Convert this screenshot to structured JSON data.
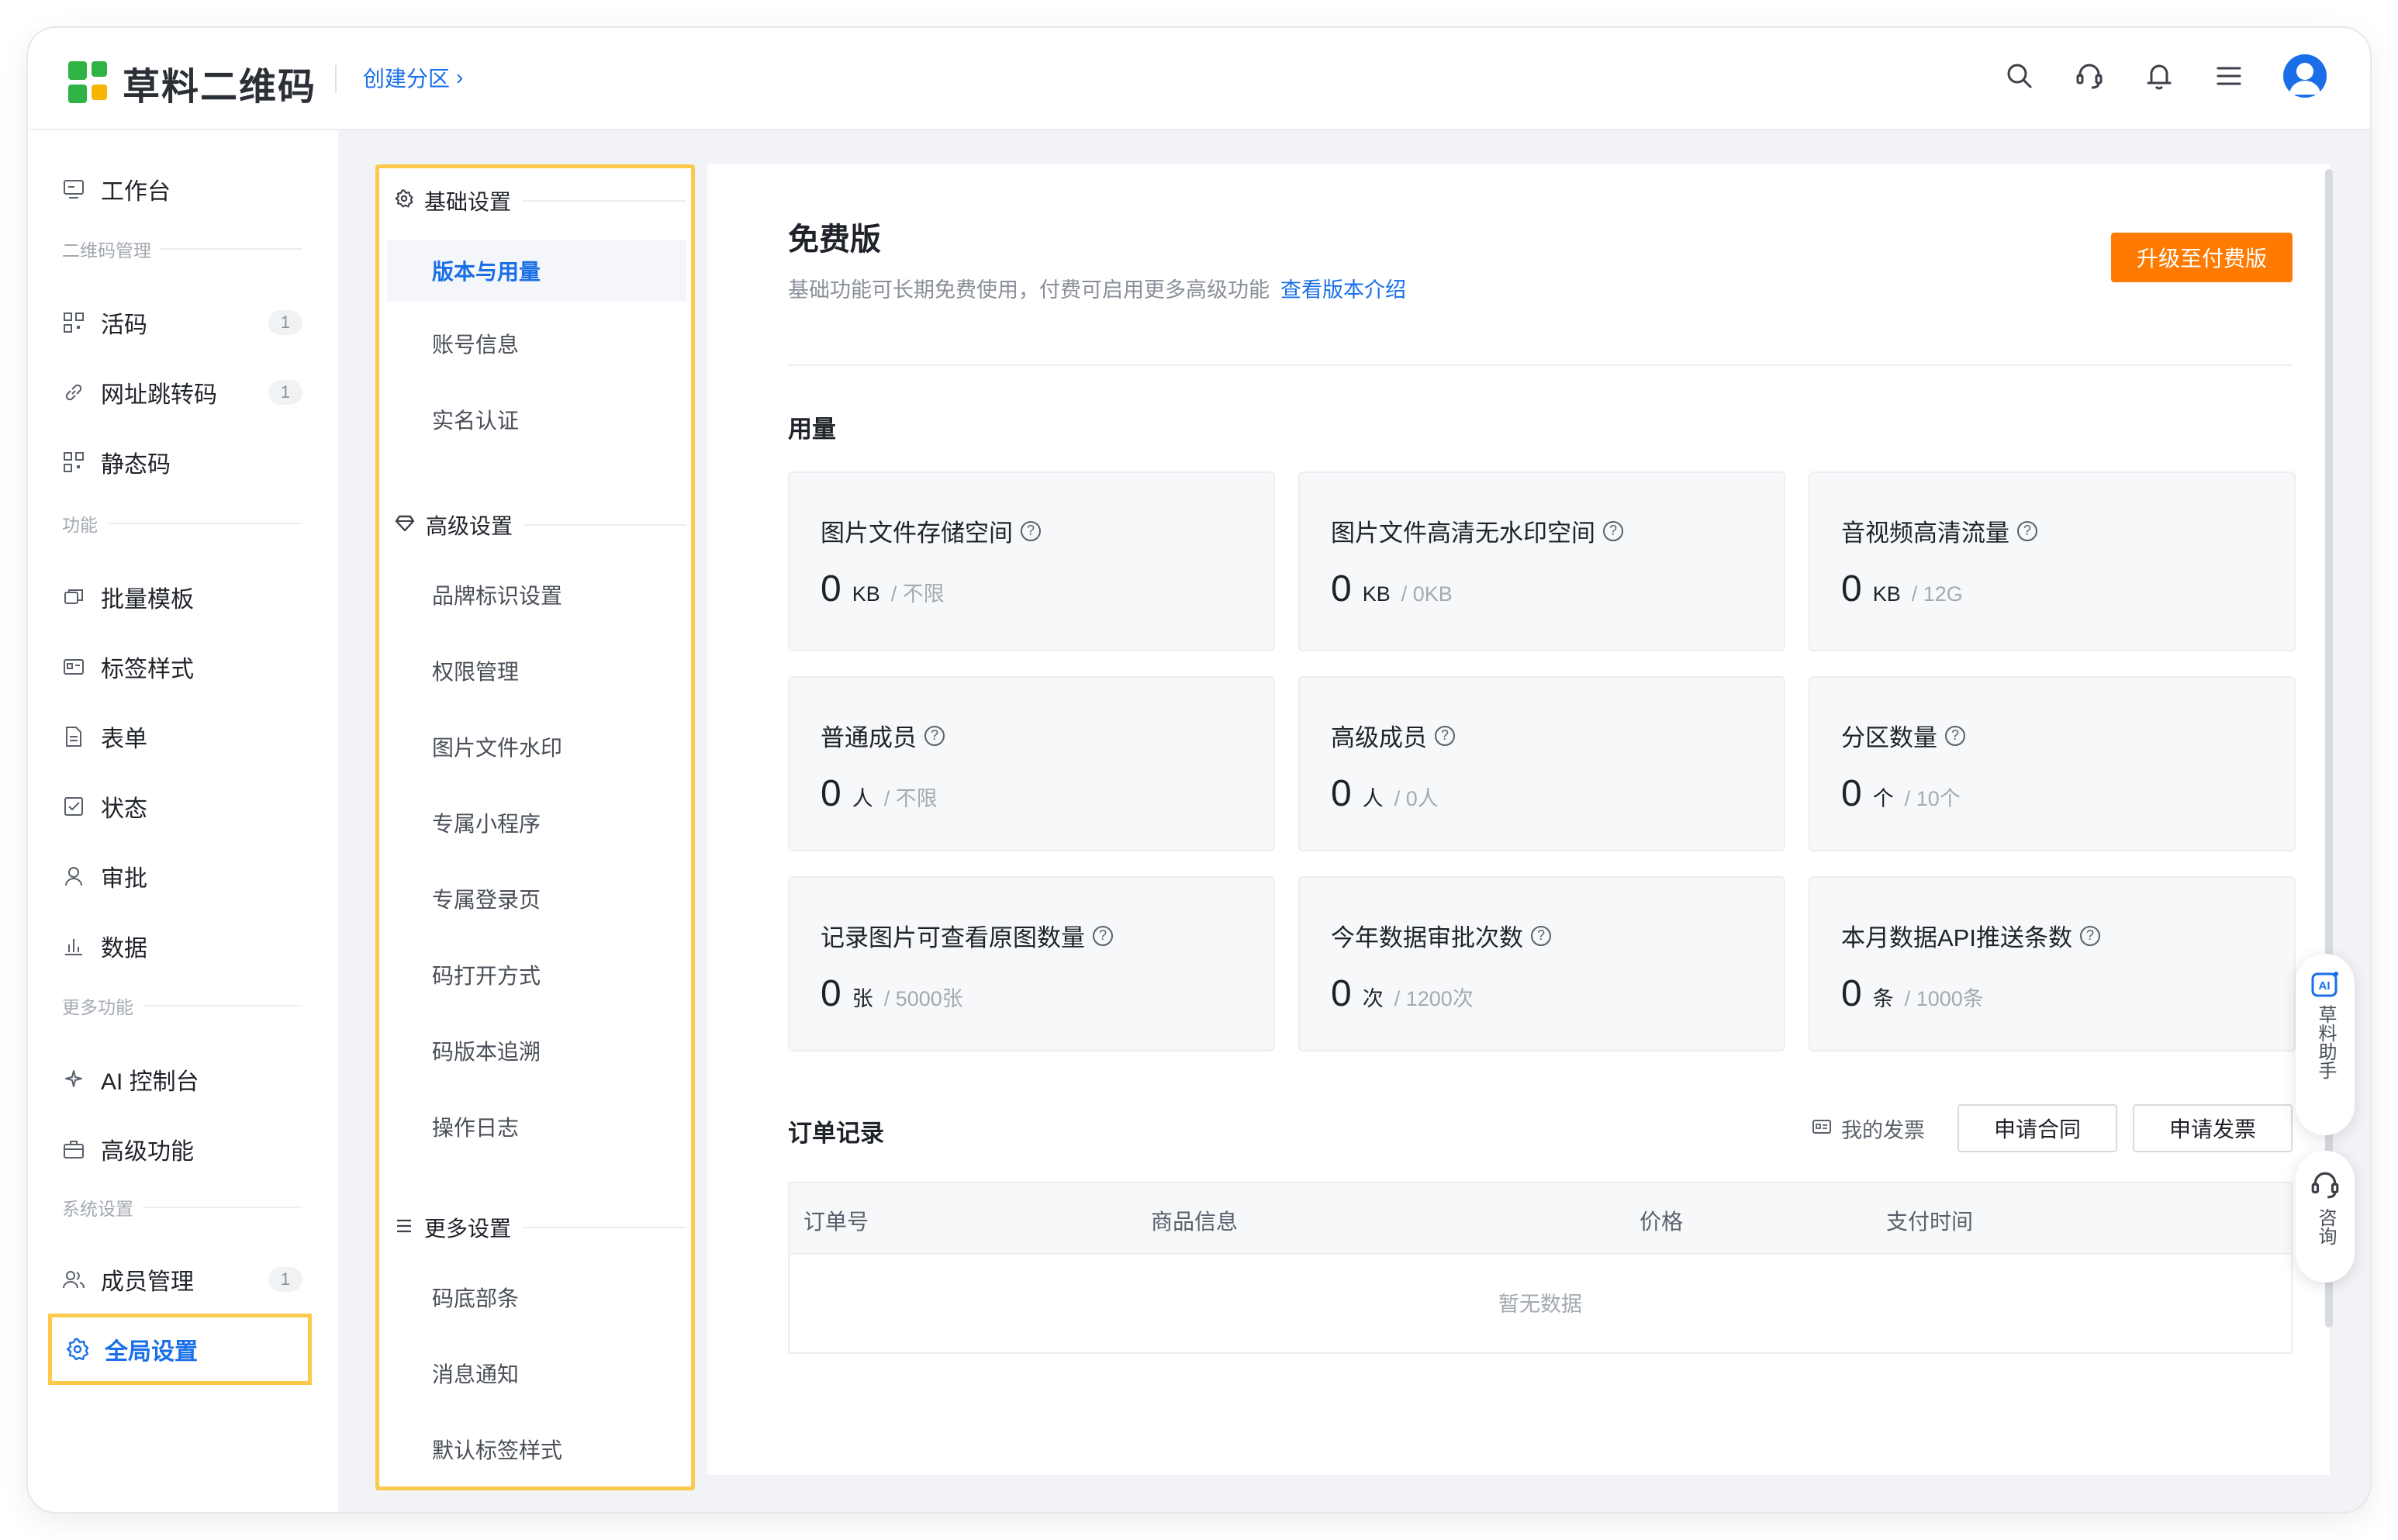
{
  "header": {
    "logo_text": "草料二维码",
    "breadcrumb": "创建分区",
    "breadcrumb_arrow": "›",
    "icons": [
      "search-icon",
      "headset-icon",
      "bell-icon",
      "menu-icon",
      "avatar"
    ]
  },
  "sidebar": {
    "workbench": "工作台",
    "groups": {
      "qr": "二维码管理",
      "features": "功能",
      "more": "更多功能",
      "system": "系统设置"
    },
    "items": {
      "live_code": {
        "label": "活码",
        "badge": "1"
      },
      "url_jump": {
        "label": "网址跳转码",
        "badge": "1"
      },
      "static_code": {
        "label": "静态码"
      },
      "batch_template": {
        "label": "批量模板"
      },
      "label_style": {
        "label": "标签样式"
      },
      "form": {
        "label": "表单"
      },
      "status": {
        "label": "状态"
      },
      "approval": {
        "label": "审批"
      },
      "data": {
        "label": "数据"
      },
      "ai_console": {
        "label": "AI 控制台"
      },
      "advanced": {
        "label": "高级功能"
      },
      "members": {
        "label": "成员管理",
        "badge": "1"
      },
      "global_settings": {
        "label": "全局设置"
      }
    }
  },
  "subnav": {
    "basic": {
      "title": "基础设置",
      "items": [
        "版本与用量",
        "账号信息",
        "实名认证"
      ]
    },
    "advanced": {
      "title": "高级设置",
      "items": [
        "品牌标识设置",
        "权限管理",
        "图片文件水印",
        "专属小程序",
        "专属登录页",
        "码打开方式",
        "码版本追溯",
        "操作日志"
      ]
    },
    "more": {
      "title": "更多设置",
      "items": [
        "码底部条",
        "消息通知",
        "默认标签样式"
      ]
    }
  },
  "plan": {
    "title": "免费版",
    "desc": "基础功能可长期免费使用，付费可启用更多高级功能",
    "link": "查看版本介绍",
    "upgrade_button": "升级至付费版"
  },
  "usage": {
    "title": "用量",
    "cards": [
      {
        "label": "图片文件存储空间",
        "value": "0",
        "unit": "KB",
        "limit": "/ 不限"
      },
      {
        "label": "图片文件高清无水印空间",
        "value": "0",
        "unit": "KB",
        "limit": "/ 0KB"
      },
      {
        "label": "音视频高清流量",
        "value": "0",
        "unit": "KB",
        "limit": "/ 12G"
      },
      {
        "label": "普通成员",
        "value": "0",
        "unit": "人",
        "limit": "/ 不限"
      },
      {
        "label": "高级成员",
        "value": "0",
        "unit": "人",
        "limit": "/ 0人"
      },
      {
        "label": "分区数量",
        "value": "0",
        "unit": "个",
        "limit": "/ 10个"
      },
      {
        "label": "记录图片可查看原图数量",
        "value": "0",
        "unit": "张",
        "limit": "/ 5000张"
      },
      {
        "label": "今年数据审批次数",
        "value": "0",
        "unit": "次",
        "limit": "/ 1200次"
      },
      {
        "label": "本月数据API推送条数",
        "value": "0",
        "unit": "条",
        "limit": "/ 1000条"
      }
    ]
  },
  "orders": {
    "title": "订单记录",
    "invoice_link": "我的发票",
    "contract_button": "申请合同",
    "invoice_button": "申请发票",
    "columns": [
      "订单号",
      "商品信息",
      "价格",
      "支付时间"
    ],
    "empty_text": "暂无数据"
  },
  "floating": {
    "ai_badge": "AI",
    "ai_label": "草料助手",
    "consult_label": "咨询"
  },
  "colors": {
    "accent": "#1a6fe8",
    "upgrade": "#ff7a00",
    "highlight": "#fbc94c"
  }
}
